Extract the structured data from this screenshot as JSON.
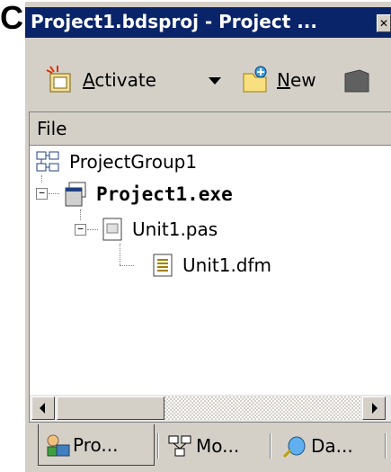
{
  "figure_label": "C",
  "window": {
    "title": "Project1.bdsproj - Project ...",
    "close_glyph": "✕"
  },
  "toolbar": {
    "activate_label": "Activate",
    "new_label": "New"
  },
  "panel": {
    "column_header": "File"
  },
  "tree": {
    "group": "ProjectGroup1",
    "project": "Project1.exe",
    "unit": "Unit1.pas",
    "form": "Unit1.dfm",
    "collapse_glyph": "−"
  },
  "tabs": [
    {
      "label": "Pro..."
    },
    {
      "label": "Mo..."
    },
    {
      "label": "Da..."
    }
  ],
  "colors": {
    "titlebar": "#0a246a",
    "face": "#d4d0c8"
  }
}
